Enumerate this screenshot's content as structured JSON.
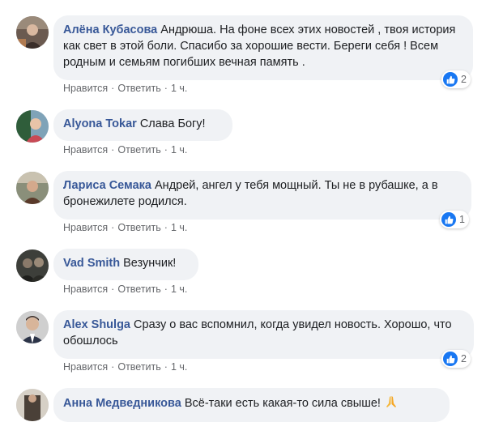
{
  "comments": [
    {
      "author": "Алёна Кубасова",
      "text": "Андрюша. На фоне всех этих новостей , твоя история как свет в этой боли. Спасибо за хорошие вести. Береги себя ! Всем родным и семьям погибших вечная память .",
      "like": "Нравится",
      "reply": "Ответить",
      "time": "1 ч.",
      "reactions": "2"
    },
    {
      "author": "Alyona Tokar",
      "text": "Слава Богу!",
      "like": "Нравится",
      "reply": "Ответить",
      "time": "1 ч."
    },
    {
      "author": "Лариса Семака",
      "text": "Андрей, ангел у тебя мощный. Ты не в рубашке, а в бронежилете родился.",
      "like": "Нравится",
      "reply": "Ответить",
      "time": "1 ч.",
      "reactions": "1"
    },
    {
      "author": "Vad Smith",
      "text": "Везунчик!",
      "like": "Нравится",
      "reply": "Ответить",
      "time": "1 ч."
    },
    {
      "author": "Alex Shulga",
      "text": "Сразу о вас вспомнил, когда увидел новость. Хорошо, что обошлось",
      "like": "Нравится",
      "reply": "Ответить",
      "time": "1 ч.",
      "reactions": "2"
    },
    {
      "author": "Анна Медведникова",
      "text": "Всё-таки есть какая-то сила свыше!",
      "emoji": "praying-hands-icon"
    }
  ],
  "separator": "·",
  "colors": {
    "author": "#385898",
    "bubble": "#f0f2f5",
    "meta": "#65676b",
    "like_badge": "#1877f2"
  }
}
